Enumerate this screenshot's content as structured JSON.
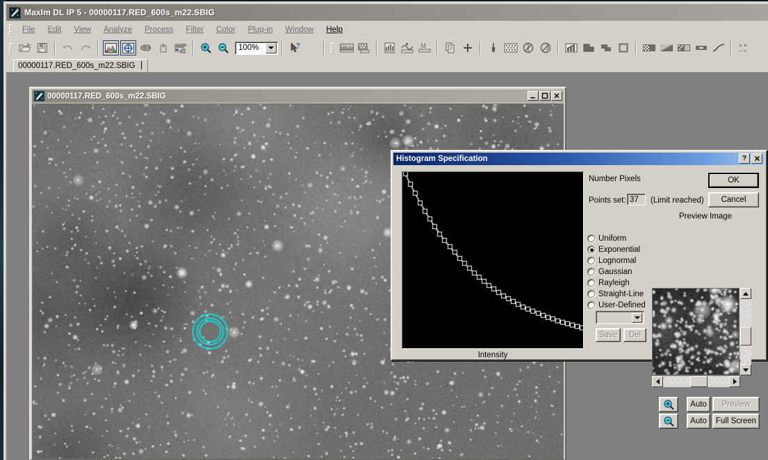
{
  "app": {
    "title": "MaxIm DL IP 5 - 00000117.RED_600s_m22.SBIG",
    "icon": "maxim-app-icon"
  },
  "menu": [
    {
      "label": "File",
      "accel": "F"
    },
    {
      "label": "Edit",
      "accel": "E"
    },
    {
      "label": "View",
      "accel": "V"
    },
    {
      "label": "Analyze",
      "accel": "A"
    },
    {
      "label": "Process",
      "accel": "P"
    },
    {
      "label": "Filter",
      "accel": "l"
    },
    {
      "label": "Color",
      "accel": "C"
    },
    {
      "label": "Plug-in",
      "accel": "g"
    },
    {
      "label": "Window",
      "accel": "W"
    },
    {
      "label": "Help",
      "accel": "H"
    }
  ],
  "toolbar": {
    "zoom_value": "100%",
    "buttons": [
      {
        "name": "open-icon"
      },
      {
        "name": "save-icon"
      },
      {
        "name": "undo-icon"
      },
      {
        "name": "redo-icon"
      },
      {
        "name": "screen-stretch-icon"
      },
      {
        "name": "crosshair-target-icon"
      },
      {
        "name": "camera-control-icon"
      },
      {
        "name": "observatory-icon"
      },
      {
        "name": "image-calibration-icon"
      },
      {
        "name": "zoom-in-icon"
      },
      {
        "name": "zoom-out-icon"
      },
      {
        "name": "help-pointer-icon"
      },
      {
        "name": "histogram-icon"
      },
      {
        "name": "pixel-math-icon"
      },
      {
        "name": "graph-window-icon"
      },
      {
        "name": "line-profile-icon"
      },
      {
        "name": "measure-icon"
      },
      {
        "name": "copy-icon"
      },
      {
        "name": "add-icon"
      },
      {
        "name": "brush-icon"
      },
      {
        "name": "noise-filter-icon"
      },
      {
        "name": "kernel-filter-icon"
      },
      {
        "name": "deconvolve-icon"
      },
      {
        "name": "chart-icon"
      },
      {
        "name": "mask-icon"
      },
      {
        "name": "overlay-icon"
      },
      {
        "name": "select-square-icon"
      },
      {
        "name": "gradient-a-icon"
      },
      {
        "name": "gradient-b-icon"
      },
      {
        "name": "gradient-c-icon"
      },
      {
        "name": "flat-icon"
      },
      {
        "name": "curve-icon"
      },
      {
        "name": "math-ops-icon"
      }
    ]
  },
  "tab": {
    "label": "00000117.RED_600s_m22.SBIG"
  },
  "image_window": {
    "title": "00000117.RED_600s_m22.SBIG",
    "icon": "maxim-doc-icon",
    "minimize_label": "_",
    "maximize_label": "□",
    "close_label": "✕",
    "annotation": "three-concentric-cyan-circles"
  },
  "dialog": {
    "title": "Histogram Specification",
    "help_label": "?",
    "close_label": "✕",
    "plot": {
      "xlabel": "Intensity",
      "ylabel": "Number Pixels"
    },
    "points_set_label": "Points set:",
    "points_set_value": "37",
    "limit_note": "(Limit reached)",
    "ok_label": "OK",
    "cancel_label": "Cancel",
    "preview_label": "Preview Image",
    "functions": [
      {
        "label": "Uniform",
        "selected": false
      },
      {
        "label": "Exponential",
        "selected": true
      },
      {
        "label": "Lognormal",
        "selected": false
      },
      {
        "label": "Gaussian",
        "selected": false
      },
      {
        "label": "Rayleigh",
        "selected": false
      },
      {
        "label": "Straight-Line",
        "selected": false
      },
      {
        "label": "User-Defined",
        "selected": false
      }
    ],
    "preset_combo_value": "",
    "save_label": "Save",
    "del_label": "Del",
    "zoom_in_icon": "zoom-in-icon",
    "zoom_out_icon": "zoom-out-icon",
    "auto_top_label": "Auto",
    "auto_bottom_label": "Auto",
    "preview_button_label": "Preview",
    "full_screen_label": "Full Screen"
  },
  "chart_data": {
    "type": "line",
    "title": "Histogram Specification transfer curve",
    "xlabel": "Intensity",
    "ylabel": "Number Pixels",
    "grid": false,
    "legend": null,
    "xlim": [
      0,
      36
    ],
    "ylim": [
      0,
      1
    ],
    "marker": "open-square",
    "line_color": "#ffffff",
    "background": "#000000",
    "n_points": 37,
    "x": [
      0,
      1,
      2,
      3,
      4,
      5,
      6,
      7,
      8,
      9,
      10,
      11,
      12,
      13,
      14,
      15,
      16,
      17,
      18,
      19,
      20,
      21,
      22,
      23,
      24,
      25,
      26,
      27,
      28,
      29,
      30,
      31,
      32,
      33,
      34,
      35,
      36
    ],
    "y": [
      1.0,
      0.941,
      0.886,
      0.834,
      0.785,
      0.739,
      0.695,
      0.654,
      0.616,
      0.58,
      0.546,
      0.514,
      0.484,
      0.455,
      0.429,
      0.404,
      0.38,
      0.358,
      0.337,
      0.317,
      0.298,
      0.281,
      0.264,
      0.249,
      0.234,
      0.221,
      0.208,
      0.196,
      0.184,
      0.173,
      0.163,
      0.154,
      0.145,
      0.136,
      0.128,
      0.121,
      0.114
    ]
  },
  "colors": {
    "window_face": "#d4d0c8",
    "mdi_background": "#808080",
    "dialog_title_start": "#0a246a",
    "dialog_title_end": "#a6c8f0",
    "annotation_cyan": "#00e5e5",
    "plot_background": "#000000",
    "plot_curve": "#ffffff"
  }
}
